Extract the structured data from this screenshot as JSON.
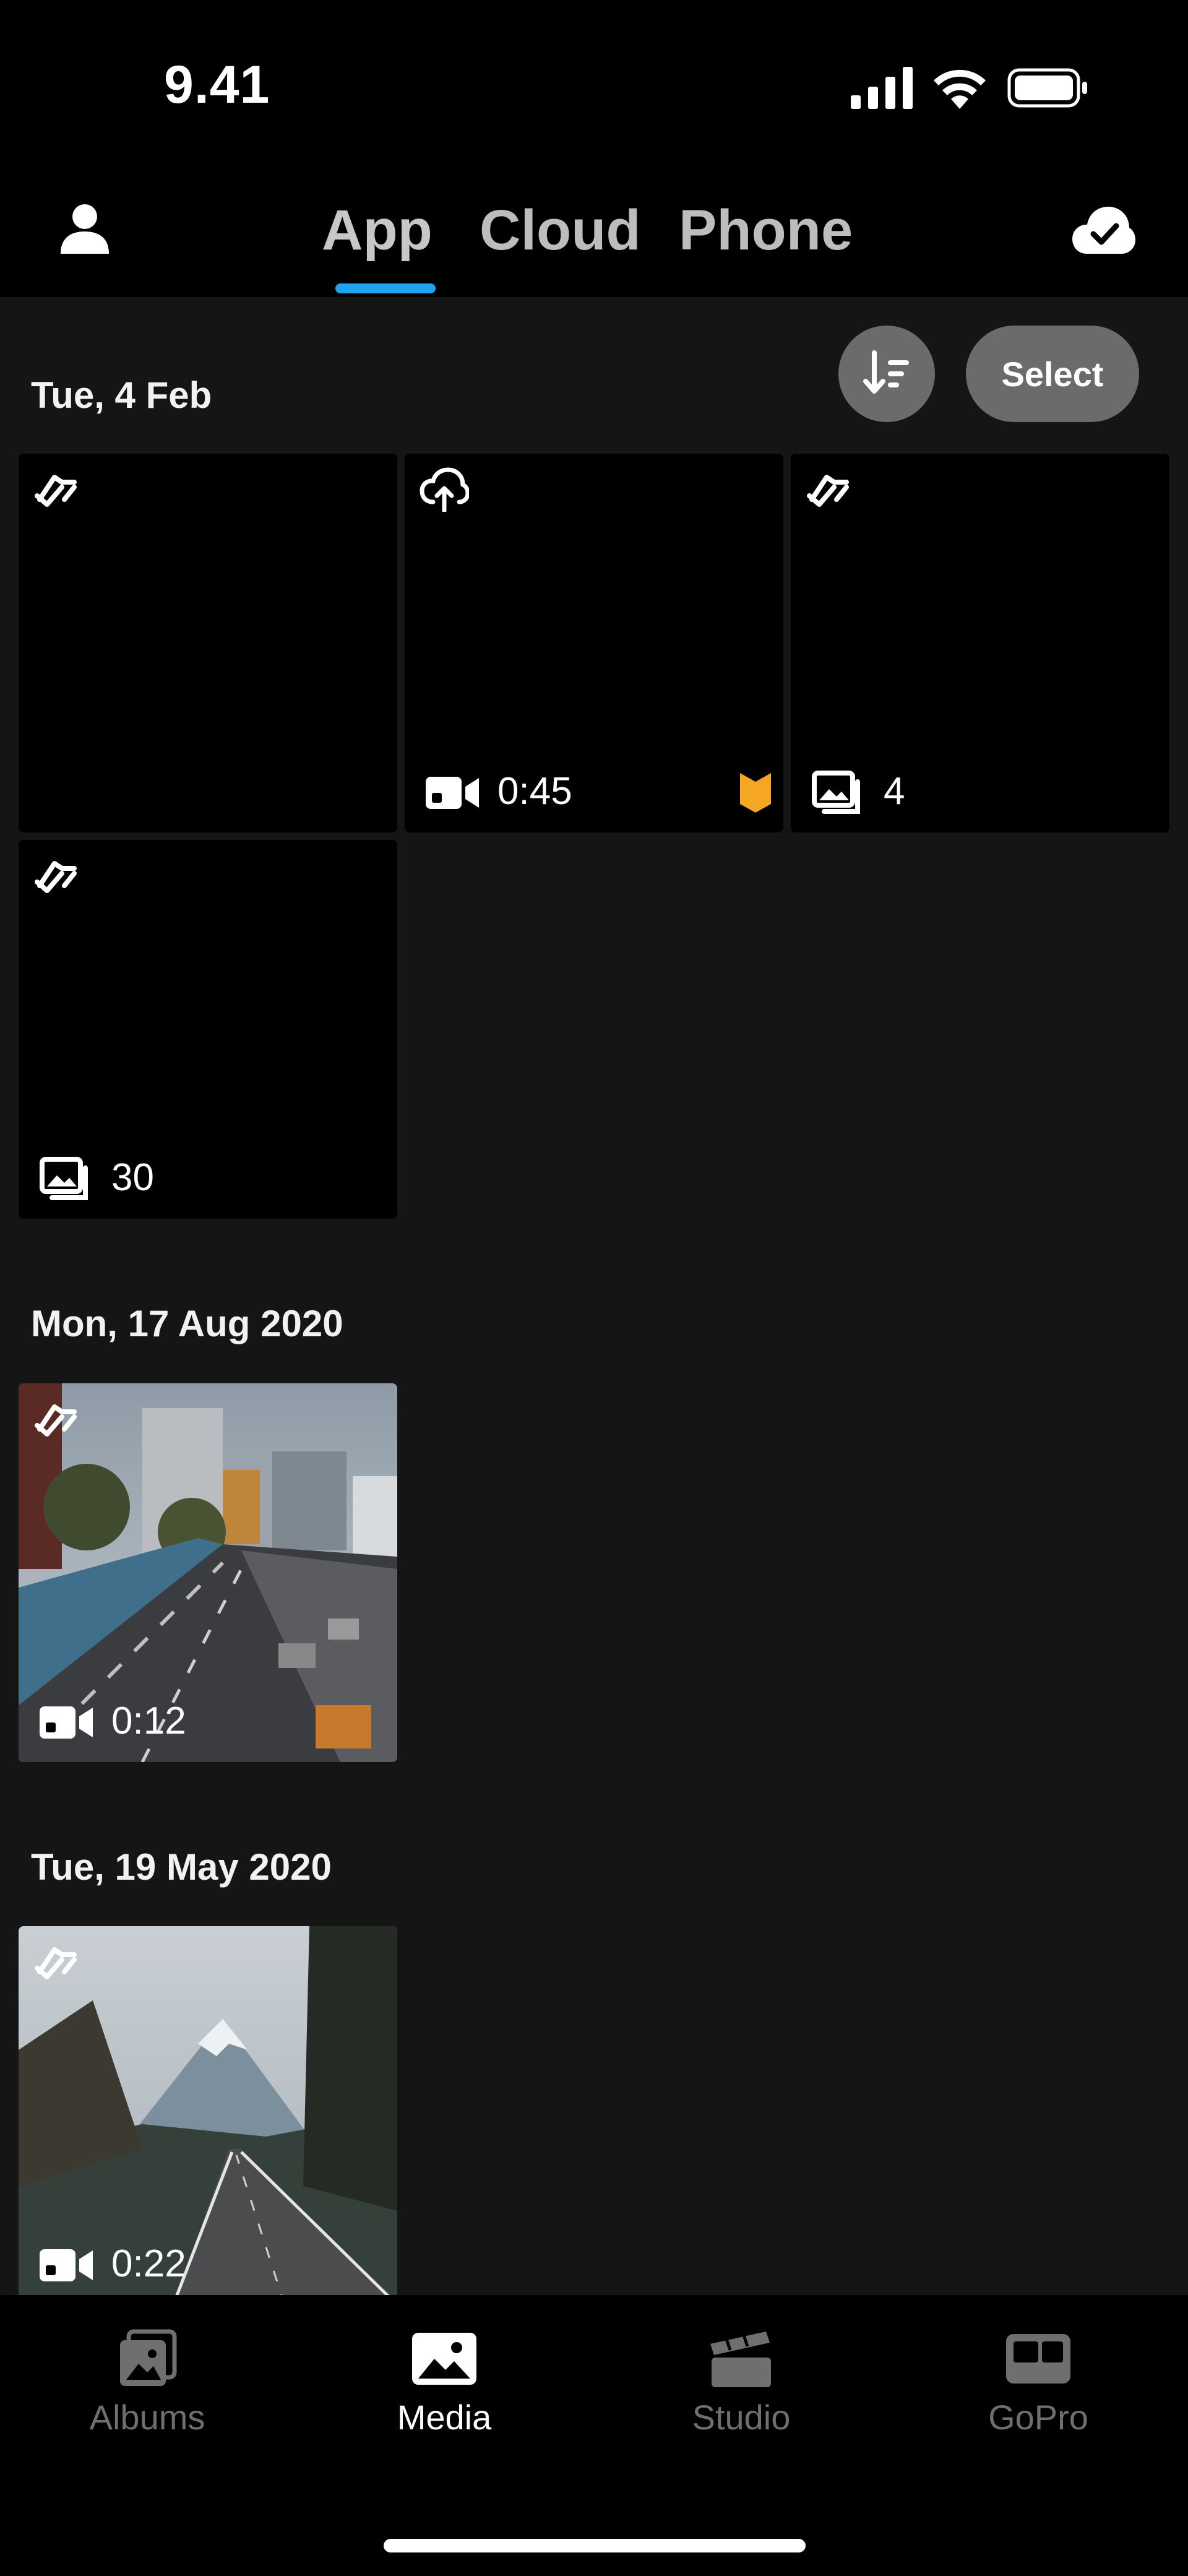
{
  "status_bar": {
    "time": "9.41"
  },
  "header": {
    "tabs": [
      {
        "label": "App",
        "active": true
      },
      {
        "label": "Cloud",
        "active": false
      },
      {
        "label": "Phone",
        "active": false
      }
    ],
    "profile_icon": "person-icon",
    "cloud_icon": "cloud-check-icon"
  },
  "toolbar": {
    "sort_icon": "sort-icon",
    "select_label": "Select"
  },
  "groups": [
    {
      "date": "Tue, 4 Feb",
      "items": [
        {
          "status_icon": "synced-icon",
          "type": "none",
          "meta": ""
        },
        {
          "status_icon": "cloud-upload-icon",
          "type": "video",
          "meta": "0:45",
          "badge": "highlight"
        },
        {
          "status_icon": "synced-icon",
          "type": "photos",
          "meta": "4"
        },
        {
          "status_icon": "synced-icon",
          "type": "photos",
          "meta": "30"
        }
      ]
    },
    {
      "date": "Mon, 17 Aug 2020",
      "items": [
        {
          "status_icon": "synced-icon",
          "type": "video",
          "meta": "0:12",
          "thumbnail": "city-highway"
        }
      ]
    },
    {
      "date": "Tue, 19 May 2020",
      "items": [
        {
          "status_icon": "synced-icon",
          "type": "video",
          "meta": "0:22",
          "thumbnail": "mountain-road"
        }
      ]
    }
  ],
  "bottom_nav": {
    "items": [
      {
        "label": "Albums",
        "active": false
      },
      {
        "label": "Media",
        "active": true
      },
      {
        "label": "Studio",
        "active": false
      },
      {
        "label": "GoPro",
        "active": false
      }
    ]
  },
  "colors": {
    "accent": "#1fa3ee",
    "highlight_badge": "#f5a623",
    "background": "#151515"
  }
}
